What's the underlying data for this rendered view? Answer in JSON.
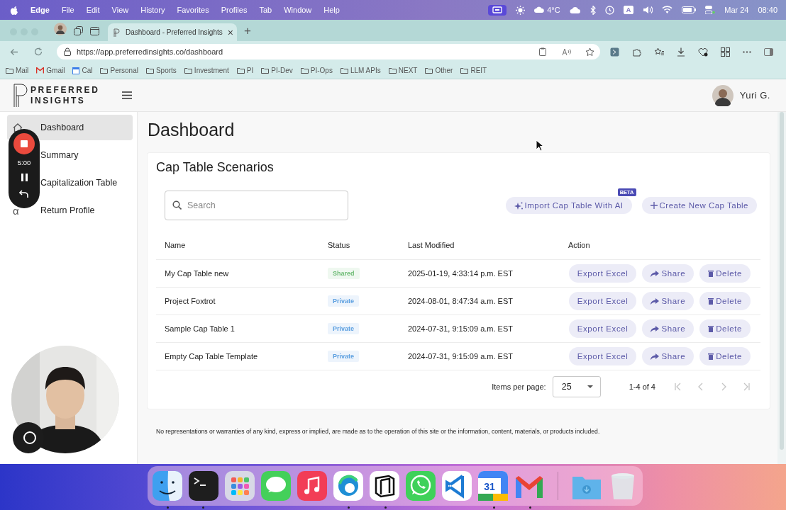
{
  "menu_bar": {
    "app": "Edge",
    "menus": [
      "File",
      "Edit",
      "View",
      "History",
      "Favorites",
      "Profiles",
      "Tab",
      "Window",
      "Help"
    ],
    "weather": "4°C",
    "input_source": "A",
    "date": "Mar 24",
    "time": "08:40"
  },
  "browser": {
    "tab": {
      "title": "Dashboard - Preferred Insights",
      "close": "×"
    },
    "new_tab": "+",
    "url": "https://app.preferredinsights.co/dashboard",
    "bookmarks": [
      {
        "label": "Mail",
        "kind": "folder"
      },
      {
        "label": "Gmail",
        "kind": "gmail"
      },
      {
        "label": "Cal",
        "kind": "calendar"
      },
      {
        "label": "Personal",
        "kind": "folder"
      },
      {
        "label": "Sports",
        "kind": "folder"
      },
      {
        "label": "Investment",
        "kind": "folder"
      },
      {
        "label": "PI",
        "kind": "folder"
      },
      {
        "label": "PI-Dev",
        "kind": "folder"
      },
      {
        "label": "PI-Ops",
        "kind": "folder"
      },
      {
        "label": "LLM APIs",
        "kind": "folder"
      },
      {
        "label": "NEXT",
        "kind": "folder"
      },
      {
        "label": "Other",
        "kind": "folder"
      },
      {
        "label": "REIT",
        "kind": "folder"
      }
    ]
  },
  "app": {
    "logo": [
      "PREFERRED",
      "INSIGHTS"
    ],
    "user": "Yuri G.",
    "sidebar": [
      {
        "label": "Dashboard",
        "selected": true
      },
      {
        "label": "Summary",
        "selected": false
      },
      {
        "label": "Capitalization Table",
        "selected": false
      },
      {
        "label": "Return Profile",
        "selected": false,
        "glyph": "α"
      }
    ]
  },
  "page": {
    "title": "Dashboard",
    "card_title": "Cap Table Scenarios",
    "search": {
      "placeholder": "Search"
    },
    "buttons": [
      {
        "label": "Import Cap Table With AI",
        "kind": "ai",
        "badge": "BETA"
      },
      {
        "label": "Create New Cap Table",
        "kind": "add"
      }
    ],
    "table": {
      "columns": [
        "Name",
        "Status",
        "Last Modified",
        "Action"
      ],
      "rows": [
        {
          "name": "My Cap Table new",
          "status": {
            "label": "Shared",
            "color": "#6dbb74"
          },
          "modified": "2025-01-19, 4:33:14 p.m. EST",
          "actions": [
            {
              "label": "Export Excel",
              "kind": "export"
            },
            {
              "label": "Share",
              "kind": "share"
            },
            {
              "label": "Delete",
              "kind": "delete"
            }
          ]
        },
        {
          "name": "Project Foxtrot",
          "status": {
            "label": "Private",
            "color": "#5b9fe0"
          },
          "modified": "2024-08-01, 8:47:34 a.m. EST",
          "actions": [
            {
              "label": "Export Excel",
              "kind": "export"
            },
            {
              "label": "Share",
              "kind": "share"
            },
            {
              "label": "Delete",
              "kind": "delete"
            }
          ]
        },
        {
          "name": "Sample Cap Table 1",
          "status": {
            "label": "Private",
            "color": "#5b9fe0"
          },
          "modified": "2024-07-31, 9:15:09 a.m. EST",
          "actions": [
            {
              "label": "Export Excel",
              "kind": "export"
            },
            {
              "label": "Share",
              "kind": "share"
            },
            {
              "label": "Delete",
              "kind": "delete"
            }
          ]
        },
        {
          "name": "Empty Cap Table Template",
          "status": {
            "label": "Private",
            "color": "#5b9fe0"
          },
          "modified": "2024-07-31, 9:15:09 a.m. EST",
          "actions": [
            {
              "label": "Export Excel",
              "kind": "export"
            },
            {
              "label": "Share",
              "kind": "share"
            },
            {
              "label": "Delete",
              "kind": "delete"
            }
          ]
        }
      ]
    },
    "pagination": {
      "label": "Items per page:",
      "per_page": "25",
      "range": "1-4 of 4",
      "nav": [
        {
          "kind": "first",
          "disabled": true
        },
        {
          "kind": "prev",
          "disabled": true
        },
        {
          "kind": "next",
          "disabled": true
        },
        {
          "kind": "last",
          "disabled": true
        }
      ]
    },
    "disclaimer": "No representations or warranties of any kind, express or implied, are made as to the operation of this site or the information, content, materials, or products included."
  },
  "recorder": {
    "time": "5:00"
  },
  "dock": {
    "calendar_day": "31"
  }
}
